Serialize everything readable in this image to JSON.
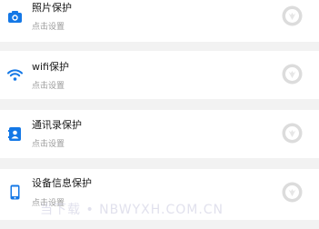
{
  "colors": {
    "accent": "#1478e6",
    "background": "#f2f2f2",
    "card": "#ffffff",
    "toggle_off": "#dcdcdc"
  },
  "items": [
    {
      "title": "照片保护",
      "subtitle": "点击设置",
      "icon": "camera-icon",
      "toggle": "off"
    },
    {
      "title": "wifi保护",
      "subtitle": "点击设置",
      "icon": "wifi-icon",
      "toggle": "off"
    },
    {
      "title": "通讯录保护",
      "subtitle": "点击设置",
      "icon": "contacts-icon",
      "toggle": "off"
    },
    {
      "title": "设备信息保护",
      "subtitle": "点击设置",
      "icon": "phone-icon",
      "toggle": "off"
    }
  ],
  "watermark": "当下载 • NBWYXH.COM.CN"
}
